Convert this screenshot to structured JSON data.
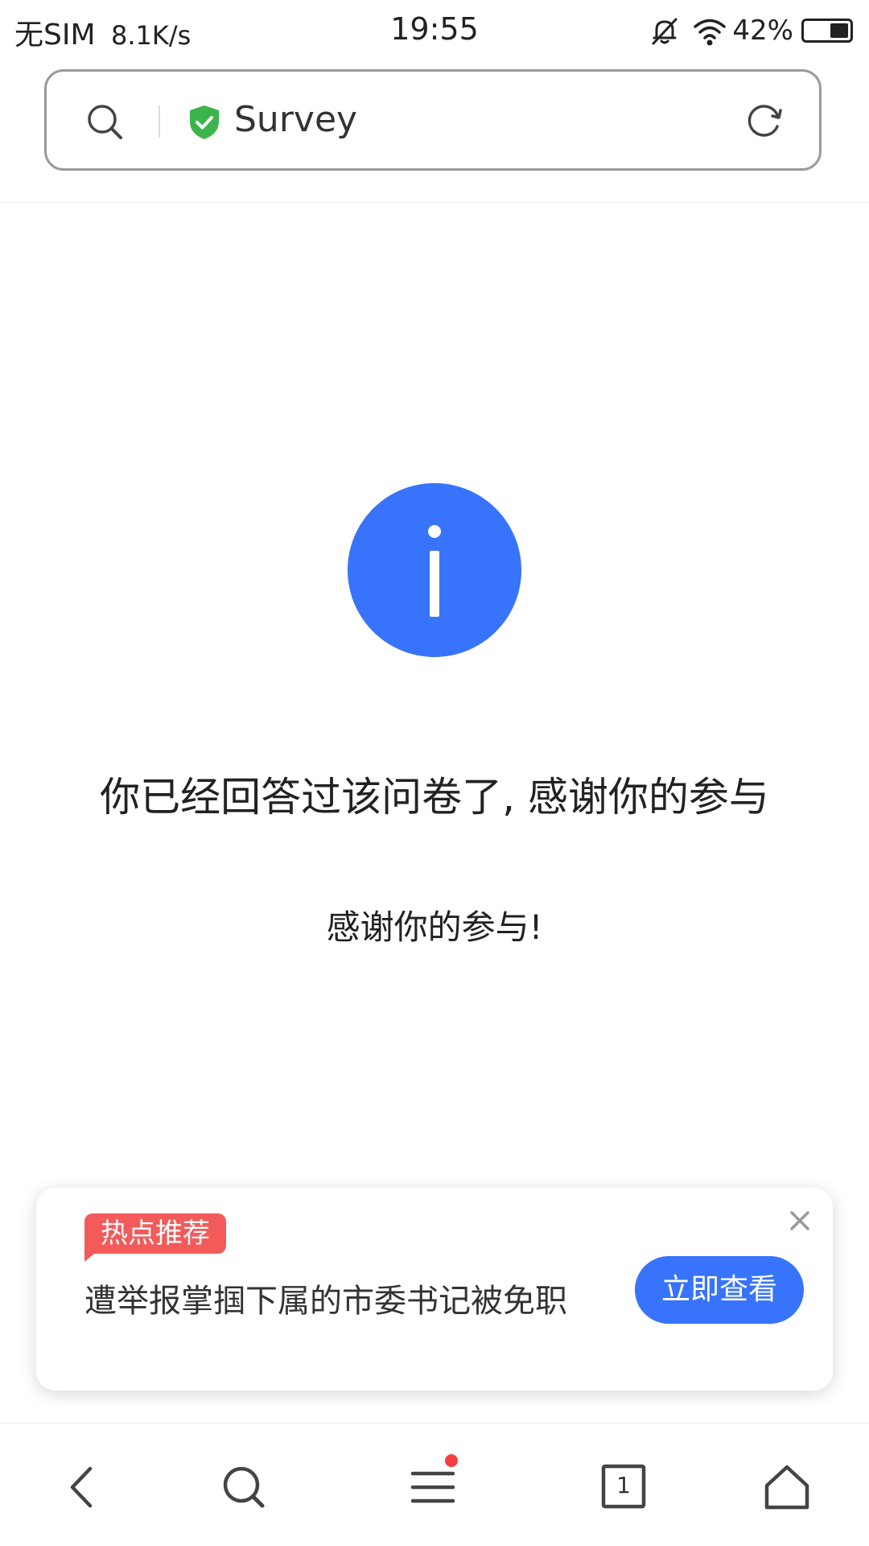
{
  "status_bar": {
    "carrier": "无SIM",
    "network_speed": "8.1K/s",
    "time": "19:55",
    "battery_percent": "42%",
    "battery_level": 0.42,
    "icons": [
      "mute-bell-icon",
      "wifi-icon",
      "battery-icon"
    ]
  },
  "address_bar": {
    "title": "Survey",
    "icons": [
      "search-icon",
      "secure-shield-icon",
      "refresh-icon"
    ],
    "shield_color": "#3cb44b"
  },
  "main": {
    "info_icon": "info-icon",
    "message": "你已经回答过该问卷了, 感谢你的参与",
    "sub_message": "感谢你的参与!"
  },
  "news_card": {
    "badge": "热点推荐",
    "headline": "遭举报掌掴下属的市委书记被免职",
    "action": "立即查看",
    "close_icon": "close-icon"
  },
  "bottom_nav": {
    "items": [
      "back-icon",
      "search-icon",
      "menu-icon",
      "tabs-icon",
      "home-icon"
    ],
    "tab_count": "1"
  },
  "colors": {
    "accent": "#3873fb",
    "badge": "#f35a5a",
    "notification_dot": "#f34040"
  }
}
